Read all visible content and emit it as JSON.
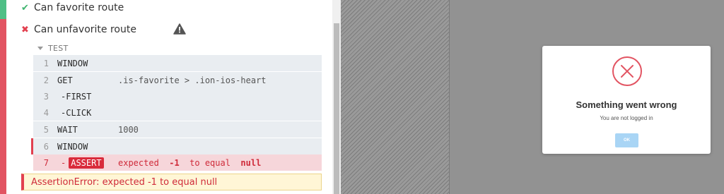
{
  "reporter": {
    "tests": [
      {
        "status": "passed",
        "icon": "check-icon",
        "title": "Can favorite route"
      },
      {
        "status": "failed",
        "icon": "cross-icon",
        "title": "Can unfavorite route"
      }
    ],
    "warning_icon": "warning-icon",
    "section_label": "TEST",
    "commands": [
      {
        "num": "1",
        "name": "WINDOW",
        "message": ""
      },
      {
        "num": "2",
        "name": "GET",
        "message": ".is-favorite > .ion-ios-heart"
      },
      {
        "num": "3",
        "name": "-FIRST",
        "message": ""
      },
      {
        "num": "4",
        "name": "-CLICK",
        "message": ""
      },
      {
        "num": "5",
        "name": "WAIT",
        "message": "1000"
      },
      {
        "num": "6",
        "name": "WINDOW",
        "message": ""
      },
      {
        "num": "7",
        "name_prefix": "-",
        "name": "ASSERT",
        "message_parts": [
          "expected",
          "-1",
          "to equal",
          "null"
        ]
      }
    ],
    "error": "AssertionError: expected -1 to equal null"
  },
  "modal": {
    "icon": "error-circle-x-icon",
    "title": "Something went wrong",
    "text": "You are not logged in",
    "button": "OK"
  },
  "colors": {
    "pass": "#4fbf86",
    "fail": "#e25462",
    "command_bg": "#e9edf1",
    "failed_row_bg": "#f6d6da",
    "error_bg": "#fff6d6",
    "modal_button": "#a9d5f5",
    "app_bg": "#929292"
  }
}
